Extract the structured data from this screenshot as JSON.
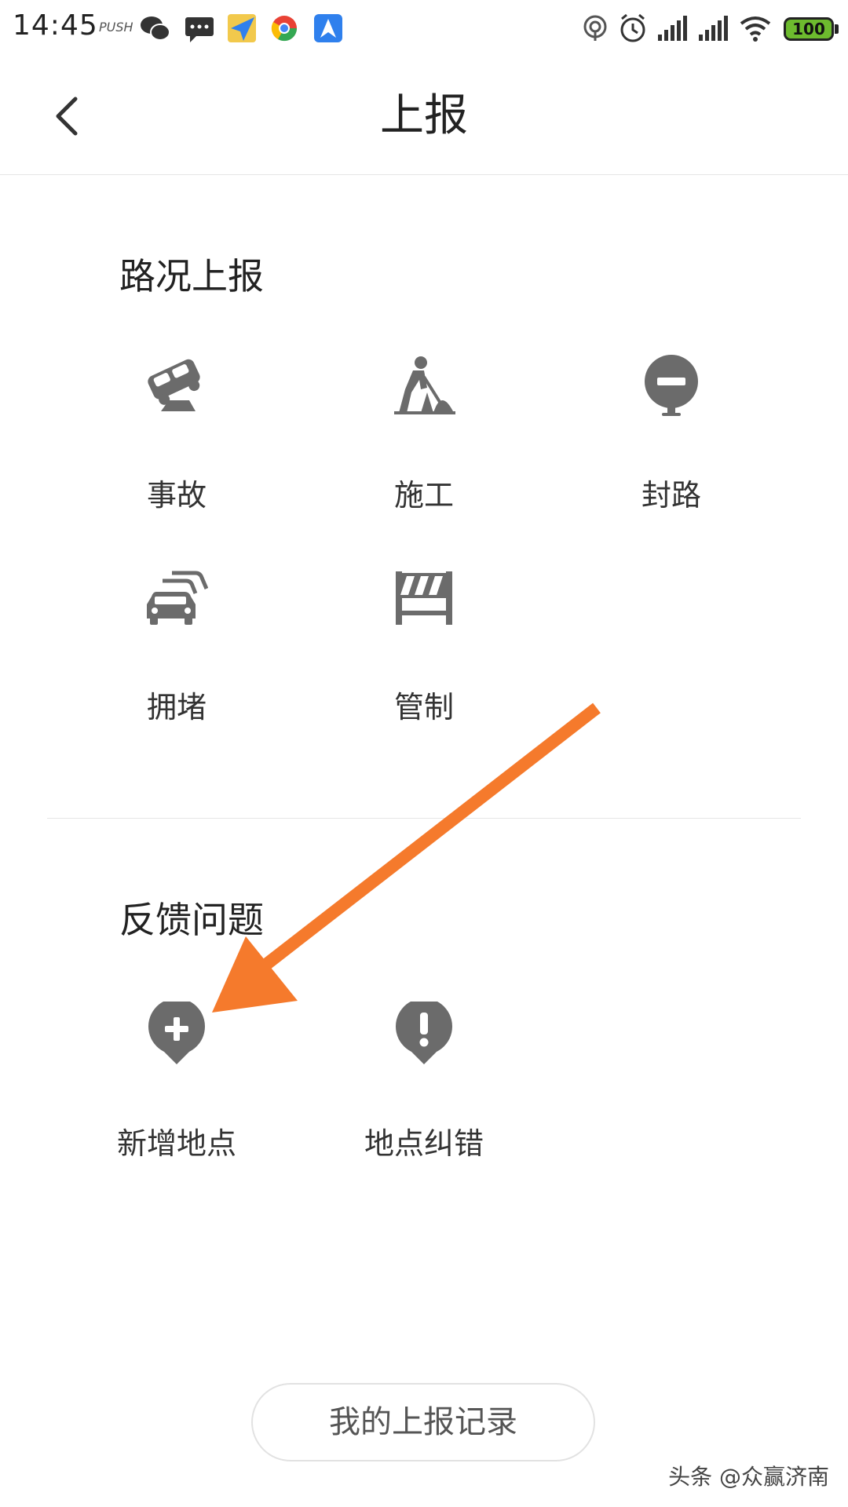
{
  "status_bar": {
    "time": "14:45",
    "push_label": "PUSH",
    "battery_level": "100",
    "icons": [
      "wechat-icon",
      "message-icon",
      "app-icon",
      "chrome-icon",
      "maps-icon",
      "hotspot-icon",
      "alarm-icon",
      "signal-icon",
      "signal-icon",
      "wifi-icon",
      "battery-icon"
    ]
  },
  "header": {
    "title": "上报"
  },
  "road_report": {
    "title": "路况上报",
    "items": [
      {
        "label": "事故",
        "icon": "accident-icon"
      },
      {
        "label": "施工",
        "icon": "construction-icon"
      },
      {
        "label": "封路",
        "icon": "road-closed-icon"
      },
      {
        "label": "拥堵",
        "icon": "traffic-jam-icon"
      },
      {
        "label": "管制",
        "icon": "barrier-icon"
      }
    ]
  },
  "feedback": {
    "title": "反馈问题",
    "items": [
      {
        "label": "新增地点",
        "icon": "add-location-icon"
      },
      {
        "label": "地点纠错",
        "icon": "location-error-icon"
      }
    ]
  },
  "records_button_label": "我的上报记录",
  "watermark": "头条 @众赢济南",
  "colors": {
    "icon_gray": "#6b6b6b",
    "arrow_orange": "#F57A2C",
    "battery_green": "#6dbb2e"
  }
}
